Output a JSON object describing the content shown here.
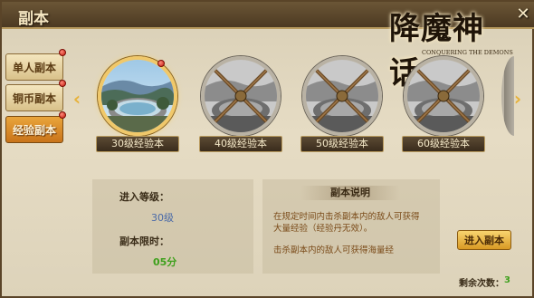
{
  "window": {
    "title": "副本",
    "close_glyph": "✕"
  },
  "logo": {
    "text": "降魔神话",
    "subtitle": "CONQUERING THE DEMONS"
  },
  "tabs": [
    {
      "label": "单人副本",
      "active": false,
      "badge": true
    },
    {
      "label": "铜币副本",
      "active": false,
      "badge": true
    },
    {
      "label": "经验副本",
      "active": true,
      "badge": true
    }
  ],
  "carousel": {
    "left_arrow": "‹",
    "right_arrow": "›",
    "items": [
      {
        "label": "30级经验本",
        "locked": false,
        "badge": true
      },
      {
        "label": "40级经验本",
        "locked": true,
        "badge": false
      },
      {
        "label": "50级经验本",
        "locked": true,
        "badge": false
      },
      {
        "label": "60级经验本",
        "locked": true,
        "badge": false
      }
    ]
  },
  "info": {
    "level_label": "进入等级：",
    "level_value": "30级",
    "time_label": "副本限时：",
    "time_value": "05分"
  },
  "description": {
    "title": "副本说明",
    "lines": [
      "在规定时间内击杀副本内的敌人可获得",
      "大量经验（经验丹无效）。",
      "击杀副本内的敌人可获得海量经"
    ]
  },
  "actions": {
    "enter_label": "进入副本"
  },
  "remaining": {
    "label": "剩余次数：",
    "value": "3"
  },
  "colors": {
    "accent": "#e7a83a",
    "level_value": "#4a6aa8",
    "time_value": "#3ea01c",
    "desc_text": "#7a4a18"
  }
}
